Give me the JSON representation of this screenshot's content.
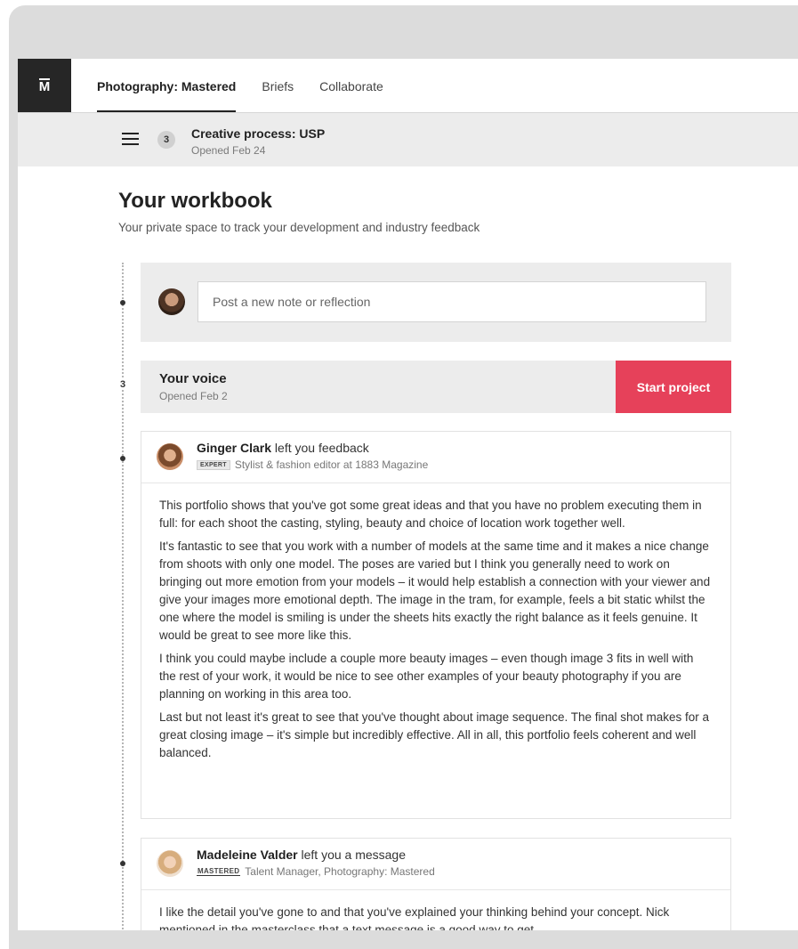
{
  "logo": {
    "text": "M"
  },
  "nav": {
    "tabs": [
      {
        "label": "Photography: Mastered",
        "active": true
      },
      {
        "label": "Briefs",
        "active": false
      },
      {
        "label": "Collaborate",
        "active": false
      }
    ]
  },
  "subheader": {
    "number": "3",
    "title": "Creative process: USP",
    "date": "Opened Feb 24"
  },
  "workbook": {
    "title": "Your workbook",
    "subtitle": "Your private space to track your development and industry feedback"
  },
  "post": {
    "placeholder": "Post a new note or reflection"
  },
  "voice": {
    "number": "3",
    "title": "Your voice",
    "date": "Opened Feb 2",
    "button": "Start project"
  },
  "feedback": [
    {
      "name": "Ginger Clark",
      "action": " left you feedback",
      "badge": "EXPERT",
      "role": "Stylist & fashion editor at 1883 Magazine",
      "paragraphs": [
        "This portfolio shows that you've got some great ideas and that you have no problem executing them in full: for each shoot the casting, styling, beauty and choice of location work together well.",
        "It's fantastic to see that you work with a number of models at the same time and it makes a nice change from shoots with only one model. The poses are varied but I think you generally need to work on bringing out more emotion from your models – it would help establish a connection with your viewer and give your images more emotional depth. The image in the tram, for example, feels a bit static whilst the one where the model is smiling is under the sheets hits exactly the right balance as it feels genuine. It would be great to see more like this.",
        "I think you could maybe include a couple more beauty images – even though image 3 fits in well with the rest of your work, it would be nice to see other examples of your beauty photography if you are planning on working in this area too.",
        "Last but not least it's great to see that you've thought about image sequence. The final shot makes for a great closing image – it's simple but incredibly effective. All in all, this portfolio feels coherent and well balanced."
      ]
    },
    {
      "name": "Madeleine Valder",
      "action": " left you a message",
      "badge": "MASTERED",
      "role": "Talent Manager, Photography: Mastered",
      "paragraphs": [
        "I like the detail you've gone to and that you've explained your thinking behind your concept. Nick mentioned in the masterclass that a text message is a good way to get"
      ]
    }
  ]
}
